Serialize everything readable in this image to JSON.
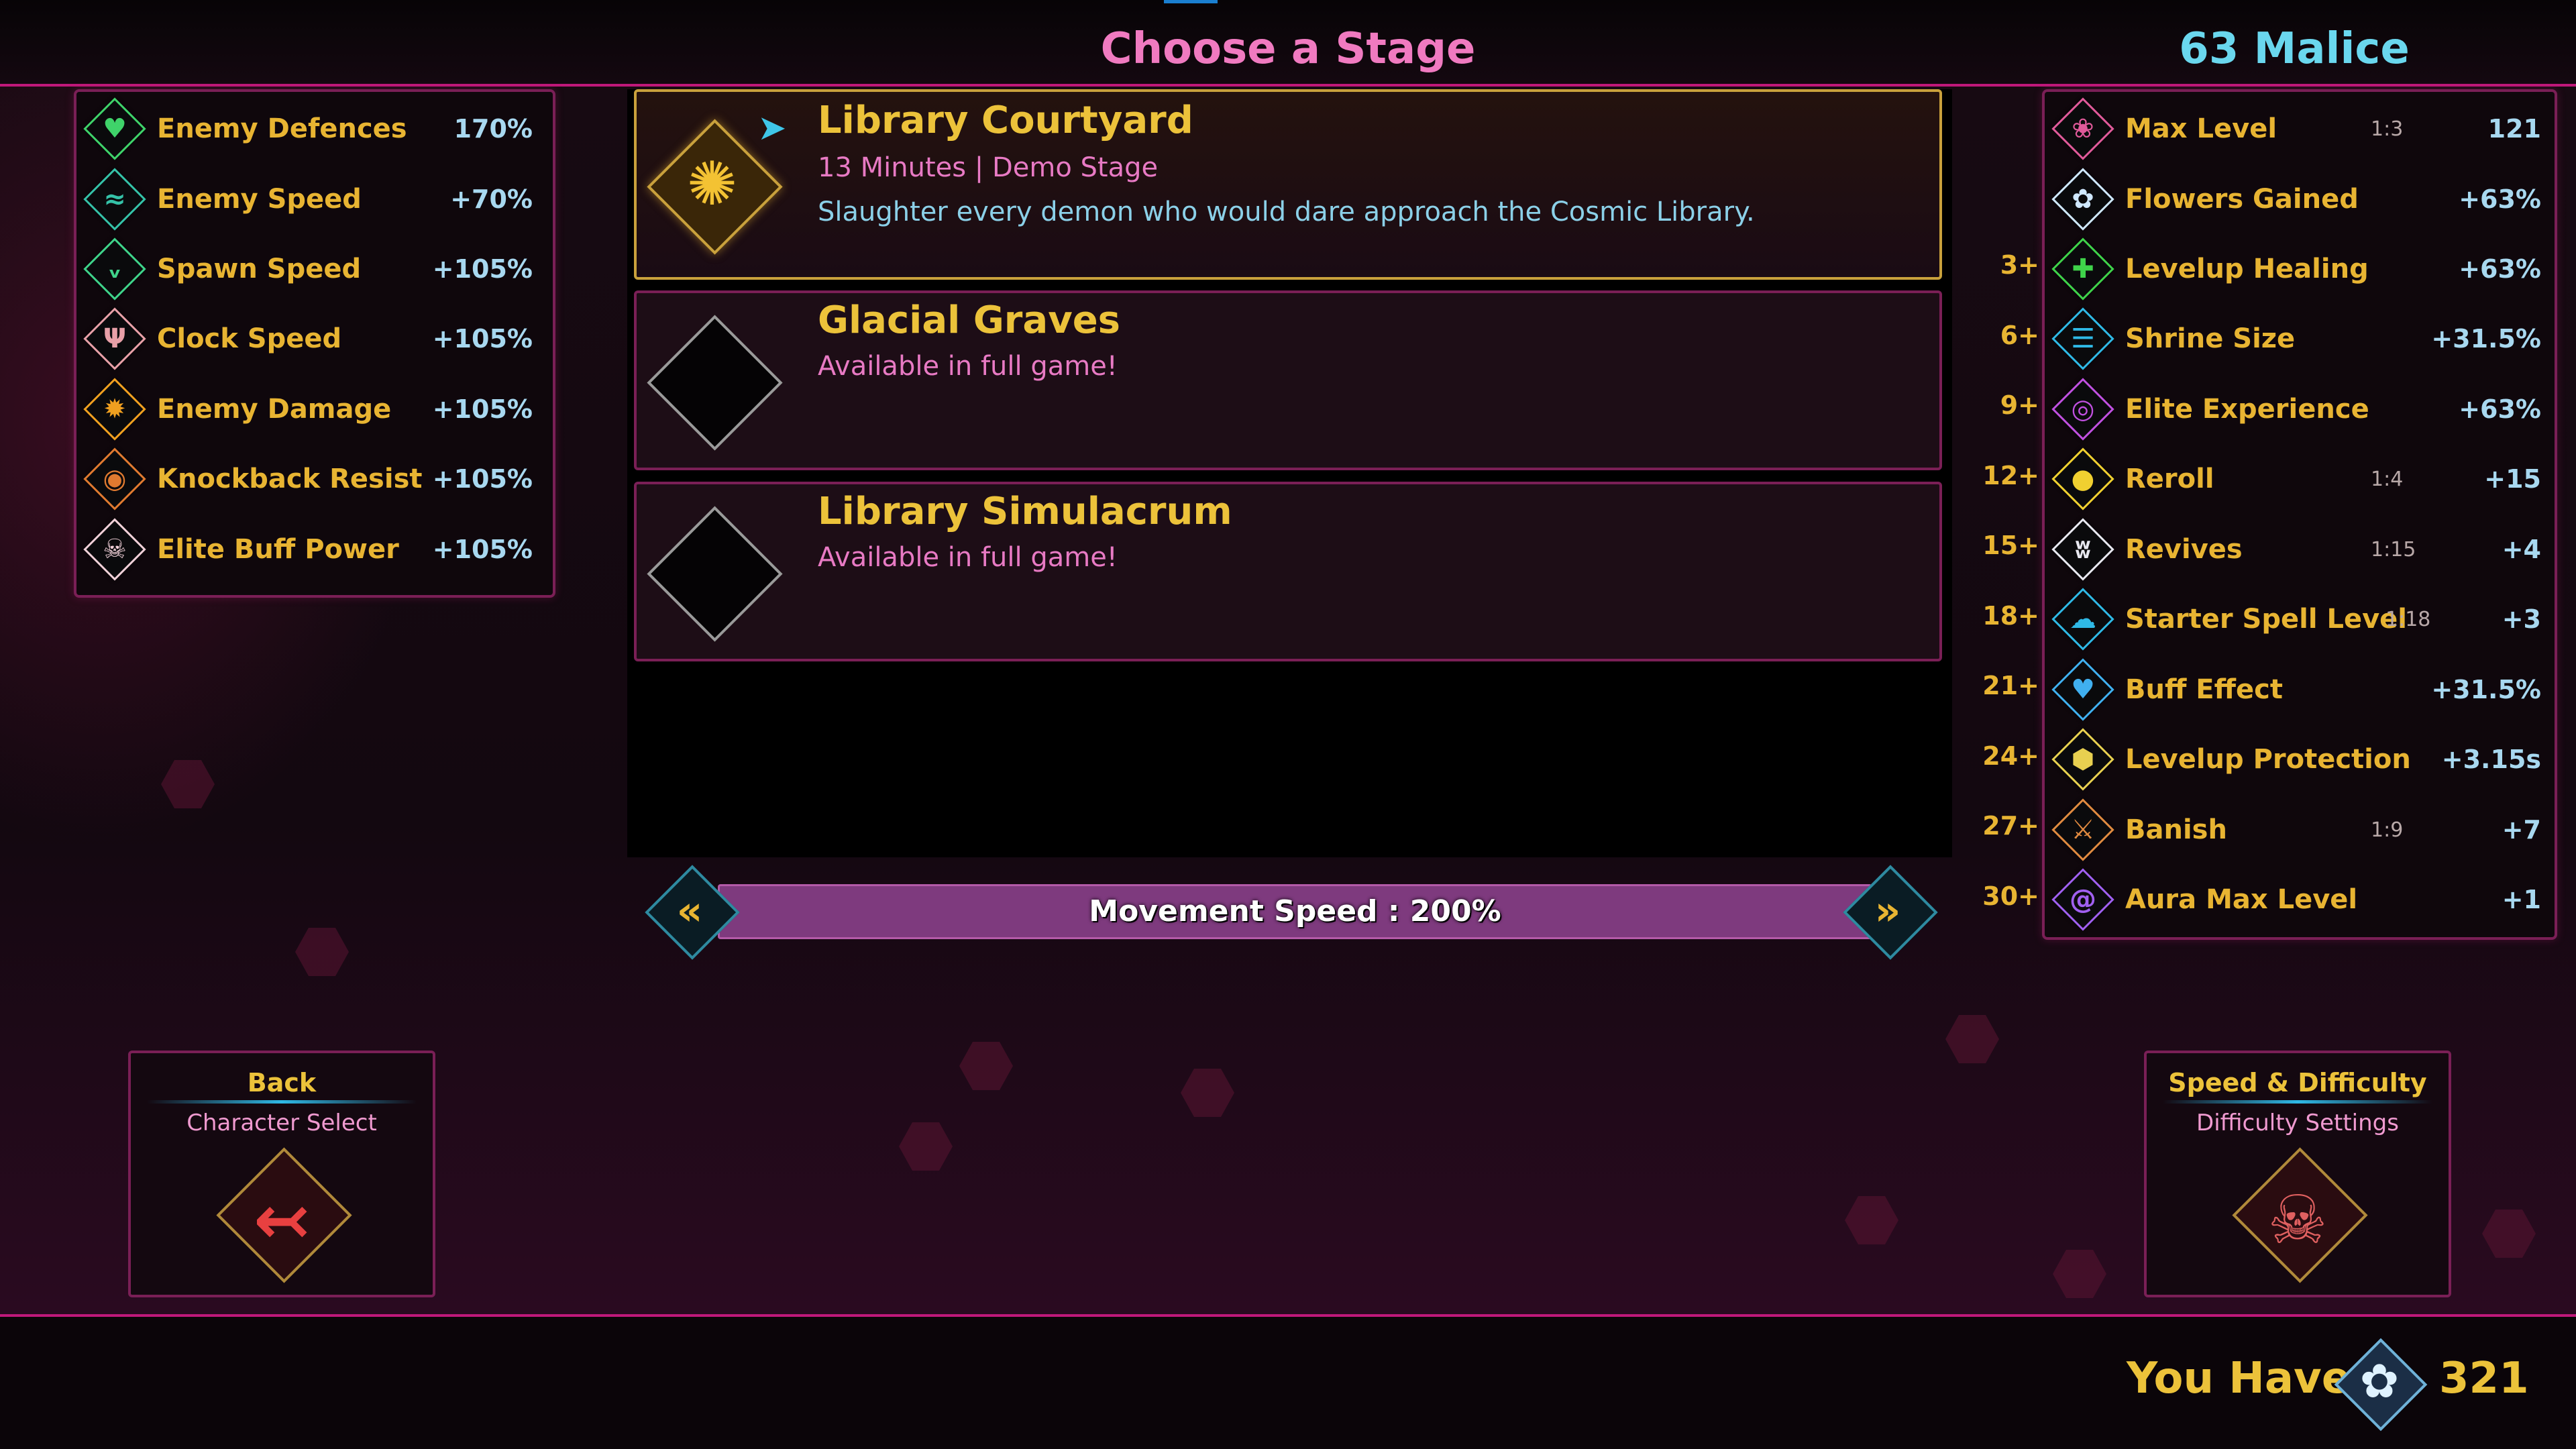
{
  "header": {
    "title": "Choose a Stage",
    "malice": "63 Malice"
  },
  "modifiers": [
    {
      "icon": "heart-icon",
      "label": "Enemy Defences",
      "value": "170%",
      "color": "#3fd36a"
    },
    {
      "icon": "wing-icon",
      "label": "Enemy Speed",
      "value": "+70%",
      "color": "#35c2a8"
    },
    {
      "icon": "bird-icon",
      "label": "Spawn Speed",
      "value": "+105%",
      "color": "#3fd38a"
    },
    {
      "icon": "tree-icon",
      "label": "Clock Speed",
      "value": "+105%",
      "color": "#e8a0a8"
    },
    {
      "icon": "flame-icon",
      "label": "Enemy Damage",
      "value": "+105%",
      "color": "#f0a020"
    },
    {
      "icon": "lion-icon",
      "label": "Knockback Resist",
      "value": "+105%",
      "color": "#e07a30"
    },
    {
      "icon": "skull-icon",
      "label": "Elite Buff Power",
      "value": "+105%",
      "color": "#f0d0d8"
    }
  ],
  "stages": [
    {
      "title": "Library Courtyard",
      "subtitle": "13 Minutes | Demo Stage",
      "description": "Slaughter every demon who would dare approach the Cosmic Library.",
      "selected": true
    },
    {
      "title": "Glacial Graves",
      "subtitle": "Available in full game!",
      "selected": false
    },
    {
      "title": "Library Simulacrum",
      "subtitle": "Available in full game!",
      "selected": false
    }
  ],
  "speed": {
    "label": "Movement Speed : 200%"
  },
  "bonuses": [
    {
      "tier": "",
      "icon": "rose-icon",
      "label": "Max Level",
      "ratio": "1:3",
      "value": "121",
      "color": "#e05a9a"
    },
    {
      "tier": "",
      "icon": "flower-icon",
      "label": "Flowers Gained",
      "ratio": "",
      "value": "+63%",
      "color": "#cfe8ff"
    },
    {
      "tier": "3+",
      "icon": "cross-icon",
      "label": "Levelup Healing",
      "ratio": "",
      "value": "+63%",
      "color": "#3fd34a"
    },
    {
      "tier": "6+",
      "icon": "shrine-icon",
      "label": "Shrine Size",
      "ratio": "",
      "value": "+31.5%",
      "color": "#2fb9e6"
    },
    {
      "tier": "9+",
      "icon": "orb-icon",
      "label": "Elite Experience",
      "ratio": "",
      "value": "+63%",
      "color": "#c050e0"
    },
    {
      "tier": "12+",
      "icon": "bag-icon",
      "label": "Reroll",
      "ratio": "1:4",
      "value": "+15",
      "color": "#f0d030"
    },
    {
      "tier": "15+",
      "icon": "wings-icon",
      "label": "Revives",
      "ratio": "1:15",
      "value": "+4",
      "color": "#e8e8f0"
    },
    {
      "tier": "18+",
      "icon": "brain-icon",
      "label": "Starter Spell Level",
      "ratio": "1:18",
      "value": "+3",
      "color": "#2fb9e6"
    },
    {
      "tier": "21+",
      "icon": "heart-plus-icon",
      "label": "Buff Effect",
      "ratio": "",
      "value": "+31.5%",
      "color": "#40b0f0"
    },
    {
      "tier": "24+",
      "icon": "shield-icon",
      "label": "Levelup Protection",
      "ratio": "",
      "value": "+3.15s",
      "color": "#e8d050"
    },
    {
      "tier": "27+",
      "icon": "sword-icon",
      "label": "Banish",
      "ratio": "1:9",
      "value": "+7",
      "color": "#e08a40"
    },
    {
      "tier": "30+",
      "icon": "spiral-icon",
      "label": "Aura Max Level",
      "ratio": "",
      "value": "+1",
      "color": "#a060f0"
    }
  ],
  "nav": {
    "back": {
      "title": "Back",
      "subtitle": "Character Select",
      "icon": "back-arrow-icon"
    },
    "difficulty": {
      "title": "Speed & Difficulty",
      "subtitle": "Difficulty Settings",
      "icon": "crowned-skull-icon"
    }
  },
  "currency": {
    "label": "You Have",
    "icon": "flower-icon",
    "count": "321"
  }
}
